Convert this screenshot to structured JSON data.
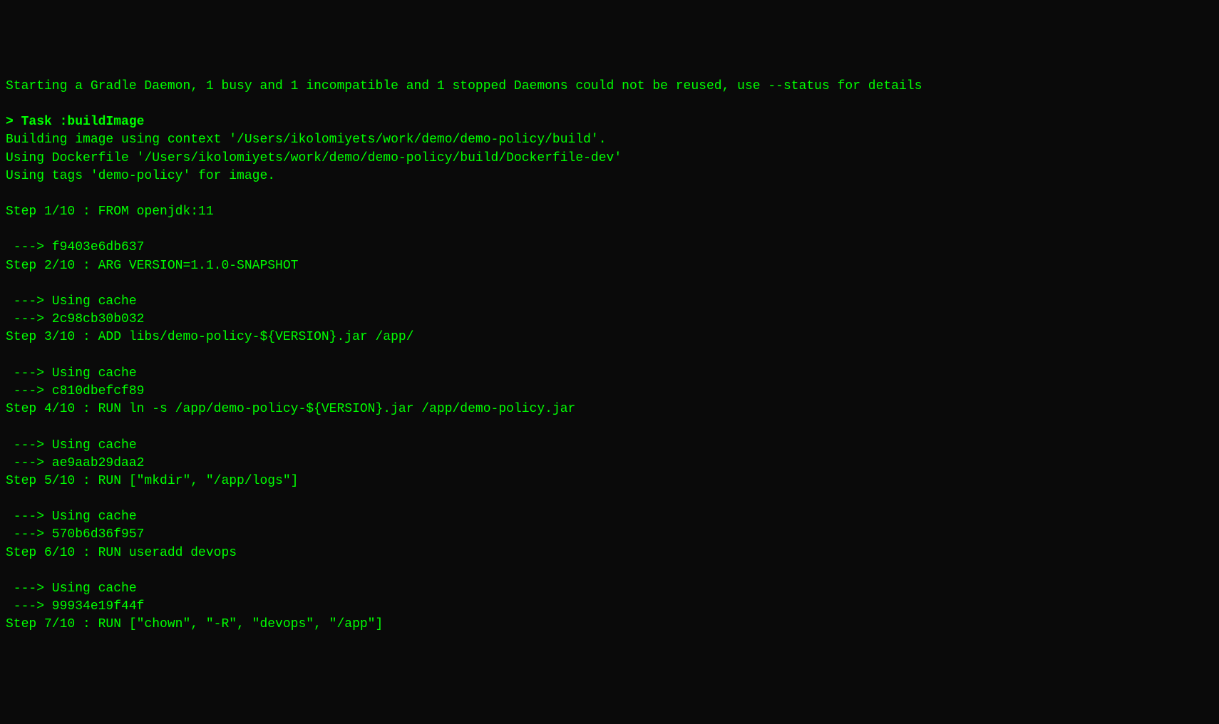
{
  "terminal": {
    "lines": [
      {
        "text": "Starting a Gradle Daemon, 1 busy and 1 incompatible and 1 stopped Daemons could not be reused, use --status for details",
        "bold": false
      },
      {
        "text": "",
        "bold": false
      },
      {
        "text": "> Task :buildImage",
        "bold": true
      },
      {
        "text": "Building image using context '/Users/ikolomiyets/work/demo/demo-policy/build'.",
        "bold": false
      },
      {
        "text": "Using Dockerfile '/Users/ikolomiyets/work/demo/demo-policy/build/Dockerfile-dev'",
        "bold": false
      },
      {
        "text": "Using tags 'demo-policy' for image.",
        "bold": false
      },
      {
        "text": "",
        "bold": false
      },
      {
        "text": "Step 1/10 : FROM openjdk:11",
        "bold": false
      },
      {
        "text": "",
        "bold": false
      },
      {
        "text": " ---> f9403e6db637",
        "bold": false
      },
      {
        "text": "Step 2/10 : ARG VERSION=1.1.0-SNAPSHOT",
        "bold": false
      },
      {
        "text": "",
        "bold": false
      },
      {
        "text": " ---> Using cache",
        "bold": false
      },
      {
        "text": " ---> 2c98cb30b032",
        "bold": false
      },
      {
        "text": "Step 3/10 : ADD libs/demo-policy-${VERSION}.jar /app/",
        "bold": false
      },
      {
        "text": "",
        "bold": false
      },
      {
        "text": " ---> Using cache",
        "bold": false
      },
      {
        "text": " ---> c810dbefcf89",
        "bold": false
      },
      {
        "text": "Step 4/10 : RUN ln -s /app/demo-policy-${VERSION}.jar /app/demo-policy.jar",
        "bold": false
      },
      {
        "text": "",
        "bold": false
      },
      {
        "text": " ---> Using cache",
        "bold": false
      },
      {
        "text": " ---> ae9aab29daa2",
        "bold": false
      },
      {
        "text": "Step 5/10 : RUN [\"mkdir\", \"/app/logs\"]",
        "bold": false
      },
      {
        "text": "",
        "bold": false
      },
      {
        "text": " ---> Using cache",
        "bold": false
      },
      {
        "text": " ---> 570b6d36f957",
        "bold": false
      },
      {
        "text": "Step 6/10 : RUN useradd devops",
        "bold": false
      },
      {
        "text": "",
        "bold": false
      },
      {
        "text": " ---> Using cache",
        "bold": false
      },
      {
        "text": " ---> 99934e19f44f",
        "bold": false
      },
      {
        "text": "Step 7/10 : RUN [\"chown\", \"-R\", \"devops\", \"/app\"]",
        "bold": false
      }
    ]
  }
}
